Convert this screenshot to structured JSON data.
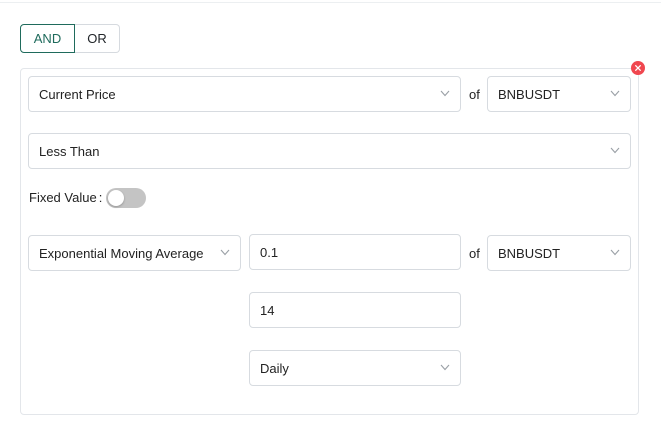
{
  "logic_toggle": {
    "and_label": "AND",
    "or_label": "OR",
    "selected": "AND"
  },
  "condition": {
    "left_indicator": {
      "value": "Current Price",
      "icon": "chevron-down-icon"
    },
    "left_of_label": "of",
    "left_symbol": {
      "value": "BNBUSDT",
      "icon": "chevron-down-icon"
    },
    "operator": {
      "value": "Less Than",
      "icon": "chevron-down-icon"
    },
    "fixed_value_label": "Fixed Value",
    "fixed_value_colon": ":",
    "fixed_value_enabled": false,
    "right_indicator": {
      "value": "Exponential Moving Average",
      "icon": "chevron-down-icon"
    },
    "right_param_1": "0.1",
    "right_of_label": "of",
    "right_symbol": {
      "value": "BNBUSDT",
      "icon": "chevron-down-icon"
    },
    "right_param_2": "14",
    "right_interval": {
      "value": "Daily",
      "icon": "chevron-down-icon"
    },
    "remove_icon": "close-icon"
  },
  "colors": {
    "accent": "#1f6b5c",
    "remove": "#f0474f",
    "switch_off": "#c4c4c4",
    "border": "#d7dbe0"
  }
}
